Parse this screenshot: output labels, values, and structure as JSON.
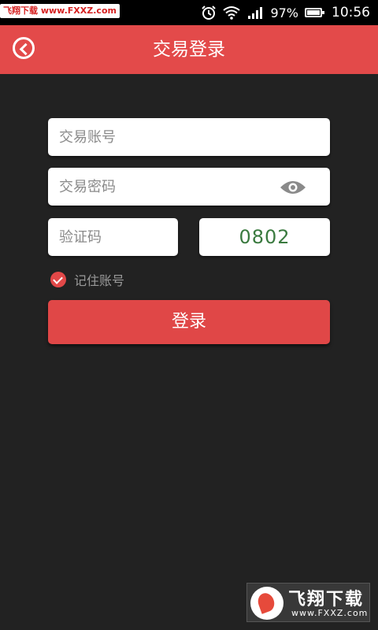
{
  "status_bar": {
    "watermark": "飞翔下载 www.FXXZ.com",
    "battery_percent": "97%",
    "time": "10:56",
    "battery_level": 0.97,
    "icons": [
      "alarm-icon",
      "wifi-icon",
      "signal-icon",
      "battery-icon"
    ]
  },
  "header": {
    "title": "交易登录",
    "back_icon": "back-circle-icon",
    "bg_color": "#e34a4a"
  },
  "form": {
    "account_placeholder": "交易账号",
    "account_value": "",
    "password_placeholder": "交易密码",
    "password_value": "",
    "password_toggle_icon": "eye-icon",
    "captcha_placeholder": "验证码",
    "captcha_value": "",
    "captcha_code": "0802",
    "captcha_color": "#3a7a3f",
    "remember_label": "记住账号",
    "remember_checked": true,
    "login_label": "登录"
  },
  "watermark": {
    "name": "飞翔下载",
    "url": "www.FXXZ.com"
  }
}
